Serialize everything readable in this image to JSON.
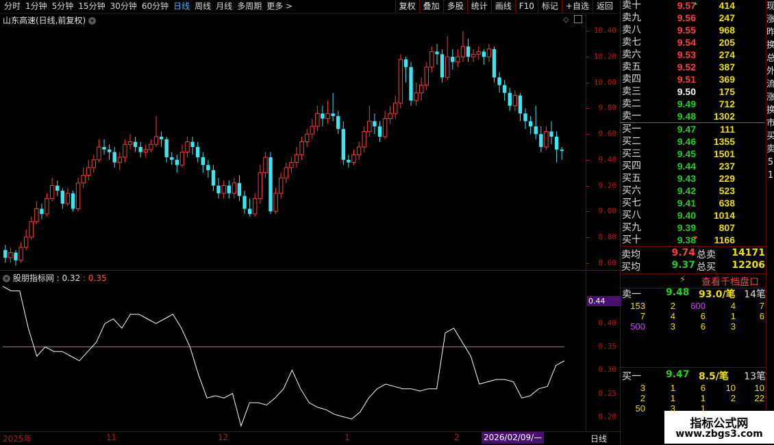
{
  "toolbar": {
    "periods": [
      "分时",
      "1分钟",
      "5分钟",
      "15分钟",
      "30分钟",
      "60分钟",
      "日线",
      "周线",
      "月线",
      "多周期",
      "更多 >"
    ],
    "active_period": "日线",
    "buttons": [
      "复权",
      "叠加",
      "多股",
      "统计",
      "画线",
      "F10",
      "标记",
      "+自选",
      "返回"
    ]
  },
  "chart": {
    "title": "山东高速(日线,前复权)",
    "y_ticks": [
      "10.40",
      "10.20",
      "10.00",
      "9.80",
      "9.60",
      "9.40",
      "9.20",
      "9.00",
      "8.80",
      "8.60"
    ]
  },
  "indicator": {
    "name": "股朋指标网",
    "value1": ": 0.32",
    "value2": ": 0.35",
    "y_ticks": [
      "0.40",
      "0.35",
      "0.30",
      "0.25",
      "0.20"
    ],
    "current_label": "0.44"
  },
  "xaxis": {
    "labels": [
      "2025年",
      "11",
      "12",
      "1",
      "2"
    ],
    "cursor_date": "2026/02/09/—",
    "period_label": "日线"
  },
  "order_book": {
    "asks": [
      {
        "label": "卖十",
        "price": "9.57",
        "vol": "414",
        "dir": "up"
      },
      {
        "label": "卖九",
        "price": "9.56",
        "vol": "247",
        "dir": "up"
      },
      {
        "label": "卖八",
        "price": "9.55",
        "vol": "968",
        "dir": "up"
      },
      {
        "label": "卖七",
        "price": "9.54",
        "vol": "205",
        "dir": "up"
      },
      {
        "label": "卖六",
        "price": "9.53",
        "vol": "274",
        "dir": "up"
      },
      {
        "label": "卖五",
        "price": "9.52",
        "vol": "387",
        "dir": "up"
      },
      {
        "label": "卖四",
        "price": "9.51",
        "vol": "369",
        "dir": "up"
      },
      {
        "label": "卖三",
        "price": "9.50",
        "vol": "175",
        "dir": "eq"
      },
      {
        "label": "卖二",
        "price": "9.49",
        "vol": "712",
        "dir": "dn"
      },
      {
        "label": "卖一",
        "price": "9.48",
        "vol": "1302",
        "dir": "dn"
      }
    ],
    "bids": [
      {
        "label": "买一",
        "price": "9.47",
        "vol": "111",
        "dir": "dn"
      },
      {
        "label": "买二",
        "price": "9.46",
        "vol": "1355",
        "dir": "dn"
      },
      {
        "label": "买三",
        "price": "9.45",
        "vol": "1501",
        "dir": "dn"
      },
      {
        "label": "买四",
        "price": "9.44",
        "vol": "237",
        "dir": "dn"
      },
      {
        "label": "买五",
        "price": "9.43",
        "vol": "229",
        "dir": "dn"
      },
      {
        "label": "买六",
        "price": "9.42",
        "vol": "523",
        "dir": "dn"
      },
      {
        "label": "买七",
        "price": "9.41",
        "vol": "638",
        "dir": "dn"
      },
      {
        "label": "买八",
        "price": "9.40",
        "vol": "1014",
        "dir": "dn"
      },
      {
        "label": "买九",
        "price": "9.39",
        "vol": "807",
        "dir": "dn"
      },
      {
        "label": "买十",
        "price": "9.38",
        "vol": "1166",
        "dir": "dn"
      }
    ],
    "avg_sell_label": "卖均",
    "avg_sell_price": "9.74",
    "total_sell_label": "总卖",
    "total_sell": "14171",
    "avg_buy_label": "买均",
    "avg_buy_price": "9.37",
    "total_buy_label": "总买",
    "total_buy": "12206"
  },
  "queue": {
    "link": "查看千档盘口",
    "ask_label": "卖一",
    "ask_price": "9.48",
    "ask_avg": "93.0/笔",
    "ask_count": "14笔",
    "ask_rows": [
      [
        "153",
        "2",
        "600",
        "4",
        "7"
      ],
      [
        "7",
        "4",
        "6",
        "1",
        "6"
      ],
      [
        "500",
        "3",
        "6",
        "3",
        ""
      ]
    ],
    "bid_label": "买一",
    "bid_price": "9.47",
    "bid_avg": "8.5/笔",
    "bid_count": "13笔",
    "bid_rows": [
      [
        "3",
        "1",
        "6",
        "10",
        "10"
      ],
      [
        "2",
        "1",
        "1",
        "2",
        "22"
      ],
      [
        "50",
        "3",
        "1",
        "",
        ""
      ]
    ]
  },
  "side_chars": [
    "现",
    "涨",
    "昨",
    "换",
    "总",
    "外",
    "流",
    "涨",
    "换",
    "市",
    "买",
    "卖",
    "5",
    "1"
  ],
  "watermark": {
    "title": "指标公式网",
    "url": "www.zbgs3.com"
  },
  "chart_data": {
    "type": "candlestick",
    "title": "山东高速(日线,前复权)",
    "ylim": [
      8.55,
      10.45
    ],
    "candles": [
      [
        8.7,
        8.64,
        8.74,
        8.6
      ],
      [
        8.64,
        8.68,
        8.72,
        8.6
      ],
      [
        8.68,
        8.62,
        8.7,
        8.58
      ],
      [
        8.62,
        8.72,
        8.76,
        8.6
      ],
      [
        8.72,
        8.8,
        8.86,
        8.7
      ],
      [
        8.8,
        8.92,
        8.96,
        8.78
      ],
      [
        8.92,
        9.02,
        9.08,
        8.9
      ],
      [
        9.02,
        8.98,
        9.06,
        8.94
      ],
      [
        8.98,
        9.1,
        9.14,
        8.96
      ],
      [
        9.1,
        9.2,
        9.26,
        9.08
      ],
      [
        9.2,
        9.16,
        9.24,
        9.12
      ],
      [
        9.16,
        9.06,
        9.18,
        9.02
      ],
      [
        9.06,
        9.14,
        9.18,
        9.04
      ],
      [
        9.14,
        9.02,
        9.16,
        9.0
      ],
      [
        9.02,
        9.22,
        9.26,
        9.0
      ],
      [
        9.22,
        9.28,
        9.34,
        9.18
      ],
      [
        9.28,
        9.34,
        9.4,
        9.24
      ],
      [
        9.34,
        9.4,
        9.44,
        9.3
      ],
      [
        9.4,
        9.5,
        9.56,
        9.38
      ],
      [
        9.5,
        9.48,
        9.56,
        9.44
      ],
      [
        9.48,
        9.46,
        9.52,
        9.4
      ],
      [
        9.46,
        9.38,
        9.5,
        9.34
      ],
      [
        9.38,
        9.42,
        9.46,
        9.32
      ],
      [
        9.42,
        9.52,
        9.56,
        9.38
      ],
      [
        9.52,
        9.54,
        9.6,
        9.48
      ],
      [
        9.54,
        9.5,
        9.58,
        9.46
      ],
      [
        9.5,
        9.46,
        9.54,
        9.42
      ],
      [
        9.46,
        9.48,
        9.52,
        9.42
      ],
      [
        9.48,
        9.52,
        9.56,
        9.46
      ],
      [
        9.52,
        9.58,
        9.74,
        9.5
      ],
      [
        9.58,
        9.56,
        9.62,
        9.5
      ],
      [
        9.56,
        9.42,
        9.58,
        9.38
      ],
      [
        9.42,
        9.4,
        9.46,
        9.36
      ],
      [
        9.4,
        9.36,
        9.44,
        9.3
      ],
      [
        9.36,
        9.46,
        9.52,
        9.34
      ],
      [
        9.46,
        9.54,
        9.58,
        9.42
      ],
      [
        9.54,
        9.5,
        9.58,
        9.44
      ],
      [
        9.5,
        9.42,
        9.54,
        9.38
      ],
      [
        9.42,
        9.36,
        9.46,
        9.3
      ],
      [
        9.36,
        9.32,
        9.4,
        9.26
      ],
      [
        9.32,
        9.2,
        9.36,
        9.16
      ],
      [
        9.2,
        9.14,
        9.26,
        9.1
      ],
      [
        9.14,
        9.2,
        9.24,
        9.1
      ],
      [
        9.2,
        9.14,
        9.24,
        9.1
      ],
      [
        9.14,
        9.22,
        9.26,
        9.1
      ],
      [
        9.22,
        9.12,
        9.28,
        9.08
      ],
      [
        9.12,
        9.02,
        9.16,
        8.98
      ],
      [
        9.02,
        8.98,
        9.1,
        8.96
      ],
      [
        8.98,
        9.1,
        9.14,
        8.96
      ],
      [
        9.1,
        9.3,
        9.36,
        9.06
      ],
      [
        9.3,
        9.42,
        9.46,
        9.26
      ],
      [
        9.42,
        9.0,
        9.46,
        8.98
      ],
      [
        9.0,
        9.14,
        9.18,
        8.98
      ],
      [
        9.14,
        9.26,
        9.3,
        9.1
      ],
      [
        9.26,
        9.34,
        9.38,
        9.22
      ],
      [
        9.34,
        9.38,
        9.42,
        9.3
      ],
      [
        9.38,
        9.44,
        9.5,
        9.34
      ],
      [
        9.44,
        9.54,
        9.58,
        9.4
      ],
      [
        9.54,
        9.6,
        9.64,
        9.5
      ],
      [
        9.6,
        9.66,
        9.72,
        9.56
      ],
      [
        9.66,
        9.76,
        9.82,
        9.62
      ],
      [
        9.76,
        9.72,
        9.82,
        9.66
      ],
      [
        9.72,
        9.76,
        9.86,
        9.68
      ],
      [
        9.76,
        9.74,
        9.92,
        9.7
      ],
      [
        9.74,
        9.64,
        9.78,
        9.6
      ],
      [
        9.64,
        9.4,
        9.7,
        9.36
      ],
      [
        9.4,
        9.38,
        9.44,
        9.34
      ],
      [
        9.38,
        9.44,
        9.48,
        9.36
      ],
      [
        9.44,
        9.5,
        9.54,
        9.4
      ],
      [
        9.5,
        9.62,
        9.66,
        9.46
      ],
      [
        9.62,
        9.7,
        9.82,
        9.58
      ],
      [
        9.7,
        9.66,
        9.76,
        9.6
      ],
      [
        9.66,
        9.58,
        9.7,
        9.54
      ],
      [
        9.58,
        9.72,
        9.78,
        9.56
      ],
      [
        9.72,
        9.76,
        9.82,
        9.68
      ],
      [
        9.76,
        9.84,
        9.9,
        9.72
      ],
      [
        9.84,
        10.18,
        10.22,
        9.8
      ],
      [
        10.18,
        10.12,
        10.2,
        10.0
      ],
      [
        10.12,
        9.86,
        10.16,
        9.82
      ],
      [
        9.86,
        9.92,
        10.0,
        9.82
      ],
      [
        9.92,
        9.98,
        10.04,
        9.86
      ],
      [
        9.98,
        10.12,
        10.16,
        9.94
      ],
      [
        10.12,
        10.24,
        10.28,
        10.08
      ],
      [
        10.24,
        10.22,
        10.3,
        10.14
      ],
      [
        10.22,
        10.04,
        10.26,
        10.0
      ],
      [
        10.04,
        10.2,
        10.36,
        10.02
      ],
      [
        10.2,
        10.16,
        10.26,
        10.1
      ],
      [
        10.16,
        10.2,
        10.26,
        10.12
      ],
      [
        10.2,
        10.28,
        10.4,
        10.16
      ],
      [
        10.28,
        10.2,
        10.34,
        10.16
      ],
      [
        10.2,
        10.22,
        10.26,
        10.16
      ],
      [
        10.22,
        10.24,
        10.28,
        10.18
      ],
      [
        10.24,
        10.2,
        10.26,
        10.14
      ],
      [
        10.2,
        10.26,
        10.3,
        10.16
      ],
      [
        10.26,
        10.04,
        10.28,
        10.0
      ],
      [
        10.04,
        9.98,
        10.08,
        9.92
      ],
      [
        9.98,
        9.92,
        10.02,
        9.86
      ],
      [
        9.92,
        9.82,
        9.96,
        9.78
      ],
      [
        9.82,
        9.9,
        9.94,
        9.78
      ],
      [
        9.9,
        9.76,
        9.92,
        9.7
      ],
      [
        9.76,
        9.7,
        9.8,
        9.64
      ],
      [
        9.7,
        9.66,
        9.74,
        9.6
      ],
      [
        9.66,
        9.6,
        9.82,
        9.56
      ],
      [
        9.6,
        9.5,
        9.66,
        9.46
      ],
      [
        9.5,
        9.62,
        9.66,
        9.48
      ],
      [
        9.62,
        9.58,
        9.7,
        9.52
      ],
      [
        9.58,
        9.48,
        9.62,
        9.38
      ],
      [
        9.48,
        9.47,
        9.5,
        9.4
      ]
    ],
    "indicator_line": [
      0.48,
      0.47,
      0.47,
      0.39,
      0.33,
      0.35,
      0.34,
      0.34,
      0.33,
      0.32,
      0.34,
      0.36,
      0.4,
      0.41,
      0.39,
      0.42,
      0.42,
      0.41,
      0.4,
      0.41,
      0.42,
      0.39,
      0.35,
      0.29,
      0.24,
      0.245,
      0.24,
      0.25,
      0.18,
      0.23,
      0.23,
      0.225,
      0.24,
      0.26,
      0.3,
      0.26,
      0.23,
      0.22,
      0.215,
      0.205,
      0.2,
      0.195,
      0.21,
      0.24,
      0.26,
      0.27,
      0.265,
      0.26,
      0.26,
      0.255,
      0.26,
      0.26,
      0.38,
      0.39,
      0.36,
      0.33,
      0.27,
      0.275,
      0.28,
      0.28,
      0.275,
      0.24,
      0.245,
      0.26,
      0.265,
      0.31,
      0.32
    ],
    "reference_level": 0.35,
    "indicator_ylim": [
      0.17,
      0.49
    ]
  }
}
